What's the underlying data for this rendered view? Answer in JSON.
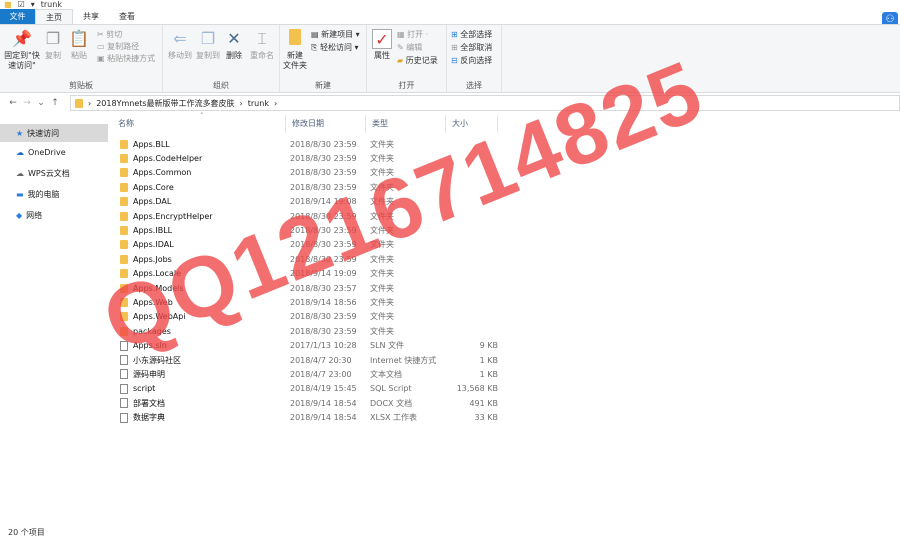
{
  "window": {
    "title": "trunk"
  },
  "tabs": [
    "文件",
    "主页",
    "共享",
    "查看"
  ],
  "ribbon": {
    "clipboard": {
      "label": "剪贴板",
      "pin": "固定到\"快速访问\"",
      "copy": "复制",
      "paste": "粘贴",
      "cut": "剪切",
      "copy_path": "复制路径",
      "paste_shortcut": "粘贴快捷方式"
    },
    "organize": {
      "label": "组织",
      "move_to": "移动到",
      "copy_to": "复制到",
      "delete": "删除",
      "rename": "重命名"
    },
    "new": {
      "label": "新建",
      "new_folder": "新建\n文件夹",
      "new_item": "新建项目",
      "easy_access": "轻松访问"
    },
    "open": {
      "label": "打开",
      "properties": "属性",
      "open": "打开",
      "edit": "编辑",
      "history": "历史记录"
    },
    "select": {
      "label": "选择",
      "select_all": "全部选择",
      "select_none": "全部取消",
      "invert": "反向选择"
    }
  },
  "address": {
    "crumbs": [
      "2018Ymnets最新版带工作流多套皮肤",
      "trunk"
    ]
  },
  "sidebar": {
    "items": [
      "快速访问",
      "OneDrive",
      "WPS云文档",
      "我的电脑",
      "网络"
    ]
  },
  "columns": [
    "名称",
    "修改日期",
    "类型",
    "大小"
  ],
  "files": [
    {
      "name": "Apps.BLL",
      "date": "2018/8/30 23:59",
      "type": "文件夹",
      "size": "",
      "kind": "folder"
    },
    {
      "name": "Apps.CodeHelper",
      "date": "2018/8/30 23:59",
      "type": "文件夹",
      "size": "",
      "kind": "folder"
    },
    {
      "name": "Apps.Common",
      "date": "2018/8/30 23:59",
      "type": "文件夹",
      "size": "",
      "kind": "folder"
    },
    {
      "name": "Apps.Core",
      "date": "2018/8/30 23:59",
      "type": "文件夹",
      "size": "",
      "kind": "folder"
    },
    {
      "name": "Apps.DAL",
      "date": "2018/9/14 19:08",
      "type": "文件夹",
      "size": "",
      "kind": "folder"
    },
    {
      "name": "Apps.EncryptHelper",
      "date": "2018/8/30 23:59",
      "type": "文件夹",
      "size": "",
      "kind": "folder"
    },
    {
      "name": "Apps.IBLL",
      "date": "2018/8/30 23:59",
      "type": "文件夹",
      "size": "",
      "kind": "folder"
    },
    {
      "name": "Apps.IDAL",
      "date": "2018/8/30 23:59",
      "type": "文件夹",
      "size": "",
      "kind": "folder"
    },
    {
      "name": "Apps.Jobs",
      "date": "2018/8/30 23:59",
      "type": "文件夹",
      "size": "",
      "kind": "folder"
    },
    {
      "name": "Apps.Locale",
      "date": "2018/9/14 19:09",
      "type": "文件夹",
      "size": "",
      "kind": "folder"
    },
    {
      "name": "Apps.Models",
      "date": "2018/8/30 23:57",
      "type": "文件夹",
      "size": "",
      "kind": "folder"
    },
    {
      "name": "Apps.Web",
      "date": "2018/9/14 18:56",
      "type": "文件夹",
      "size": "",
      "kind": "folder"
    },
    {
      "name": "Apps.WebApi",
      "date": "2018/8/30 23:59",
      "type": "文件夹",
      "size": "",
      "kind": "folder"
    },
    {
      "name": "packages",
      "date": "2018/8/30 23:59",
      "type": "文件夹",
      "size": "",
      "kind": "folder"
    },
    {
      "name": "Apps.sln",
      "date": "2017/1/13 10:28",
      "type": "SLN 文件",
      "size": "9 KB",
      "kind": "file"
    },
    {
      "name": "小东源码社区",
      "date": "2018/4/7 20:30",
      "type": "Internet 快捷方式",
      "size": "1 KB",
      "kind": "file"
    },
    {
      "name": "源码申明",
      "date": "2018/4/7 23:00",
      "type": "文本文档",
      "size": "1 KB",
      "kind": "file"
    },
    {
      "name": "script",
      "date": "2018/4/19 15:45",
      "type": "SQL Script",
      "size": "13,568 KB",
      "kind": "file"
    },
    {
      "name": "部署文档",
      "date": "2018/9/14 18:54",
      "type": "DOCX 文档",
      "size": "491 KB",
      "kind": "file"
    },
    {
      "name": "数据字典",
      "date": "2018/9/14 18:54",
      "type": "XLSX 工作表",
      "size": "33 KB",
      "kind": "file"
    }
  ],
  "status": {
    "count": "20 个项目"
  },
  "watermark": "QQ1216714825"
}
